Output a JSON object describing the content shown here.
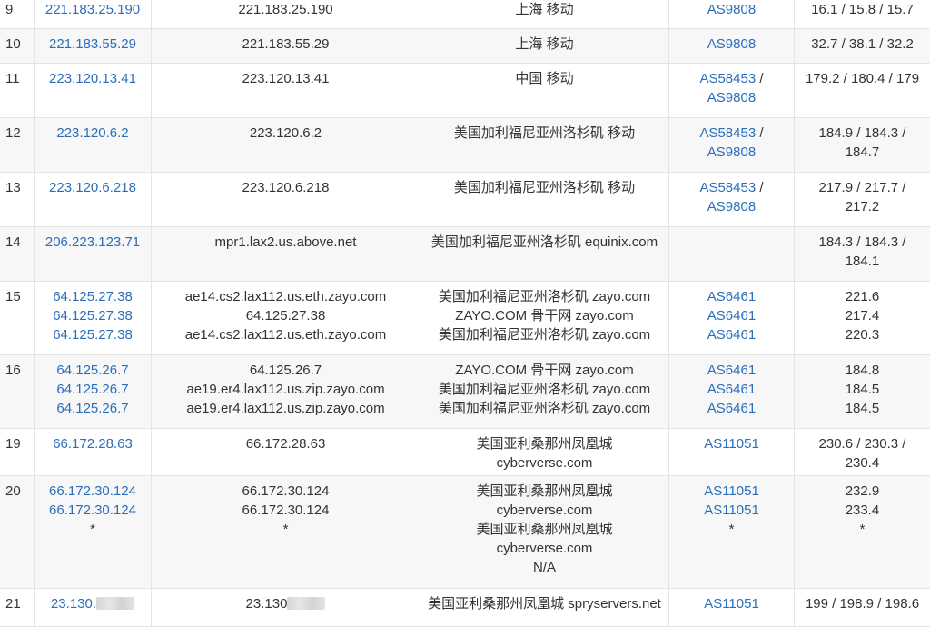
{
  "rows": [
    {
      "hop": "9",
      "ip": [
        "221.183.25.190"
      ],
      "host": [
        "221.183.25.190"
      ],
      "location": [
        "上海 移动"
      ],
      "as": [
        [
          "AS9808"
        ]
      ],
      "rtt": [
        "16.1 / 15.8 / 15.7"
      ]
    },
    {
      "hop": "10",
      "ip": [
        "221.183.55.29"
      ],
      "host": [
        "221.183.55.29"
      ],
      "location": [
        "上海 移动"
      ],
      "as": [
        [
          "AS9808"
        ]
      ],
      "rtt": [
        "32.7 / 38.1 / 32.2"
      ]
    },
    {
      "hop": "11",
      "ip": [
        "223.120.13.41"
      ],
      "host": [
        "223.120.13.41"
      ],
      "location": [
        "中国 移动"
      ],
      "as": [
        [
          "AS58453",
          " /"
        ],
        [
          "AS9808"
        ]
      ],
      "rtt": [
        "179.2 / 180.4 / 179"
      ]
    },
    {
      "hop": "12",
      "ip": [
        "223.120.6.2"
      ],
      "host": [
        "223.120.6.2"
      ],
      "location": [
        "美国加利福尼亚州洛杉矶 移动"
      ],
      "as": [
        [
          "AS58453",
          " /"
        ],
        [
          "AS9808"
        ]
      ],
      "rtt": [
        "184.9 / 184.3 /",
        "184.7"
      ]
    },
    {
      "hop": "13",
      "ip": [
        "223.120.6.218"
      ],
      "host": [
        "223.120.6.218"
      ],
      "location": [
        "美国加利福尼亚州洛杉矶 移动"
      ],
      "as": [
        [
          "AS58453",
          " /"
        ],
        [
          "AS9808"
        ]
      ],
      "rtt": [
        "217.9 / 217.7 /",
        "217.2"
      ]
    },
    {
      "hop": "14",
      "ip": [
        "206.223.123.71"
      ],
      "host": [
        "mpr1.lax2.us.above.net"
      ],
      "location": [
        "美国加利福尼亚州洛杉矶 equinix.com"
      ],
      "as": [],
      "rtt": [
        "184.3 / 184.3 /",
        "184.1"
      ]
    },
    {
      "hop": "15",
      "ip": [
        "64.125.27.38",
        "64.125.27.38",
        "64.125.27.38"
      ],
      "host": [
        "ae14.cs2.lax112.us.eth.zayo.com",
        "64.125.27.38",
        "ae14.cs2.lax112.us.eth.zayo.com"
      ],
      "location": [
        "美国加利福尼亚州洛杉矶 zayo.com",
        "ZAYO.COM 骨干网 zayo.com",
        "美国加利福尼亚州洛杉矶 zayo.com"
      ],
      "as": [
        [
          "AS6461"
        ],
        [
          "AS6461"
        ],
        [
          "AS6461"
        ]
      ],
      "rtt": [
        "221.6",
        "217.4",
        "220.3"
      ]
    },
    {
      "hop": "16",
      "ip": [
        "64.125.26.7",
        "64.125.26.7",
        "64.125.26.7"
      ],
      "host": [
        "64.125.26.7",
        "ae19.er4.lax112.us.zip.zayo.com",
        "ae19.er4.lax112.us.zip.zayo.com"
      ],
      "location": [
        "ZAYO.COM 骨干网 zayo.com",
        "美国加利福尼亚州洛杉矶 zayo.com",
        "美国加利福尼亚州洛杉矶 zayo.com"
      ],
      "as": [
        [
          "AS6461"
        ],
        [
          "AS6461"
        ],
        [
          "AS6461"
        ]
      ],
      "rtt": [
        "184.8",
        "184.5",
        "184.5"
      ]
    },
    {
      "hop": "19",
      "ip": [
        "66.172.28.63"
      ],
      "host": [
        "66.172.28.63"
      ],
      "location": [
        "美国亚利桑那州凤凰城",
        "cyberverse.com"
      ],
      "as": [
        [
          "AS11051"
        ]
      ],
      "rtt": [
        "230.6 / 230.3 /",
        "230.4"
      ]
    },
    {
      "hop": "20",
      "ip": [
        "66.172.30.124",
        "66.172.30.124",
        "*"
      ],
      "host": [
        "66.172.30.124",
        "66.172.30.124",
        "*"
      ],
      "location": [
        "美国亚利桑那州凤凰城",
        "cyberverse.com",
        "美国亚利桑那州凤凰城",
        "cyberverse.com",
        "N/A"
      ],
      "as": [
        [
          "AS11051"
        ],
        [
          "AS11051"
        ],
        [
          "*"
        ]
      ],
      "rtt": [
        "232.9",
        "233.4",
        "*"
      ]
    },
    {
      "hop": "21",
      "ip": [
        "23.130."
      ],
      "host": [
        "23.130"
      ],
      "location": [
        "美国亚利桑那州凤凰城 spryservers.net"
      ],
      "as": [
        [
          "AS11051"
        ]
      ],
      "rtt": [
        "199 / 198.9 / 198.6"
      ]
    }
  ]
}
